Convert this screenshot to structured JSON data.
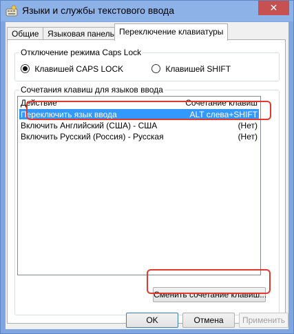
{
  "window": {
    "title": "Языки и службы текстового ввода",
    "close_glyph": "✕"
  },
  "tabs": [
    {
      "label": "Общие",
      "active": false
    },
    {
      "label": "Языковая панель",
      "active": false
    },
    {
      "label": "Переключение клавиатуры",
      "active": true
    }
  ],
  "caps_lock": {
    "legend": "Отключение режима Caps Lock",
    "options": [
      {
        "label": "Клавишей CAPS LOCK",
        "checked": true
      },
      {
        "label": "Клавишей SHIFT",
        "checked": false
      }
    ]
  },
  "hotkeys": {
    "legend": "Сочетания клавиш для языков ввода",
    "columns": {
      "action": "Действие",
      "shortcut": "Сочетание клавиш"
    },
    "rows": [
      {
        "action": "Переключить язык ввода",
        "shortcut": "ALT слева+SHIFT",
        "selected": true
      },
      {
        "action": "Включить Английский (США) - США",
        "shortcut": "(Нет)",
        "selected": false
      },
      {
        "action": "Включить Русский (Россия) - Русская",
        "shortcut": "(Нет)",
        "selected": false
      }
    ],
    "change_button": "Сменить сочетание клавиш..."
  },
  "footer": {
    "ok": "OK",
    "cancel": "Отмена",
    "apply": "Применить"
  },
  "colors": {
    "selection": "#3399ff",
    "annotation": "#e0382d",
    "title_bar": "#8db2e8",
    "close": "#c75050"
  }
}
